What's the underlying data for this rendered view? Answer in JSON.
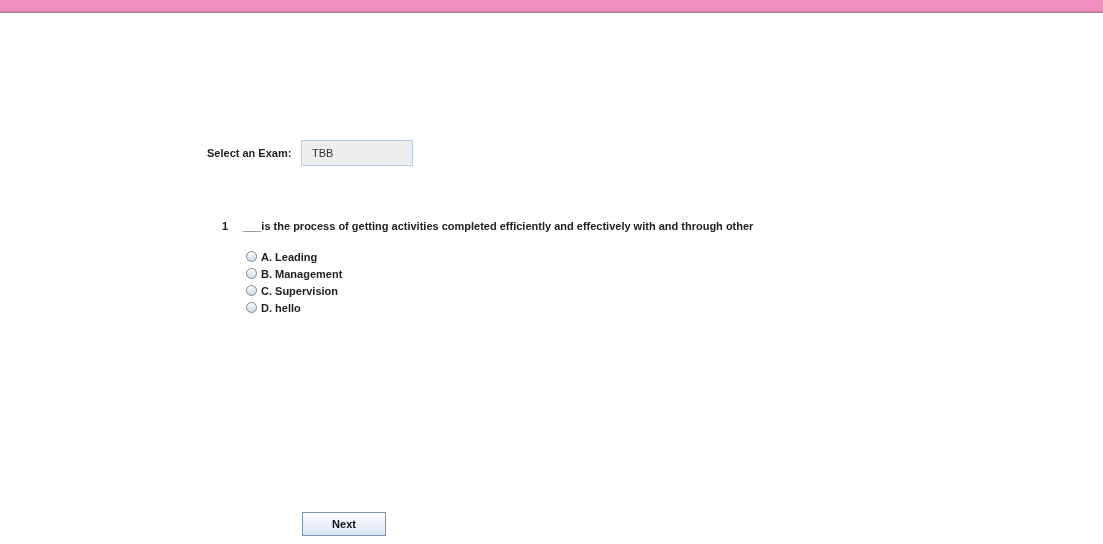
{
  "exam_selector": {
    "label": "Select an Exam:",
    "value": "TBB"
  },
  "question": {
    "number": "1",
    "text": "___is the process of getting activities completed efficiently and effectively with and through other",
    "options": [
      {
        "label": "A. Leading",
        "selected": false
      },
      {
        "label": "B. Management",
        "selected": false
      },
      {
        "label": "C. Supervision",
        "selected": false
      },
      {
        "label": "D. hello",
        "selected": false
      }
    ]
  },
  "next_button": {
    "label": "Next"
  }
}
